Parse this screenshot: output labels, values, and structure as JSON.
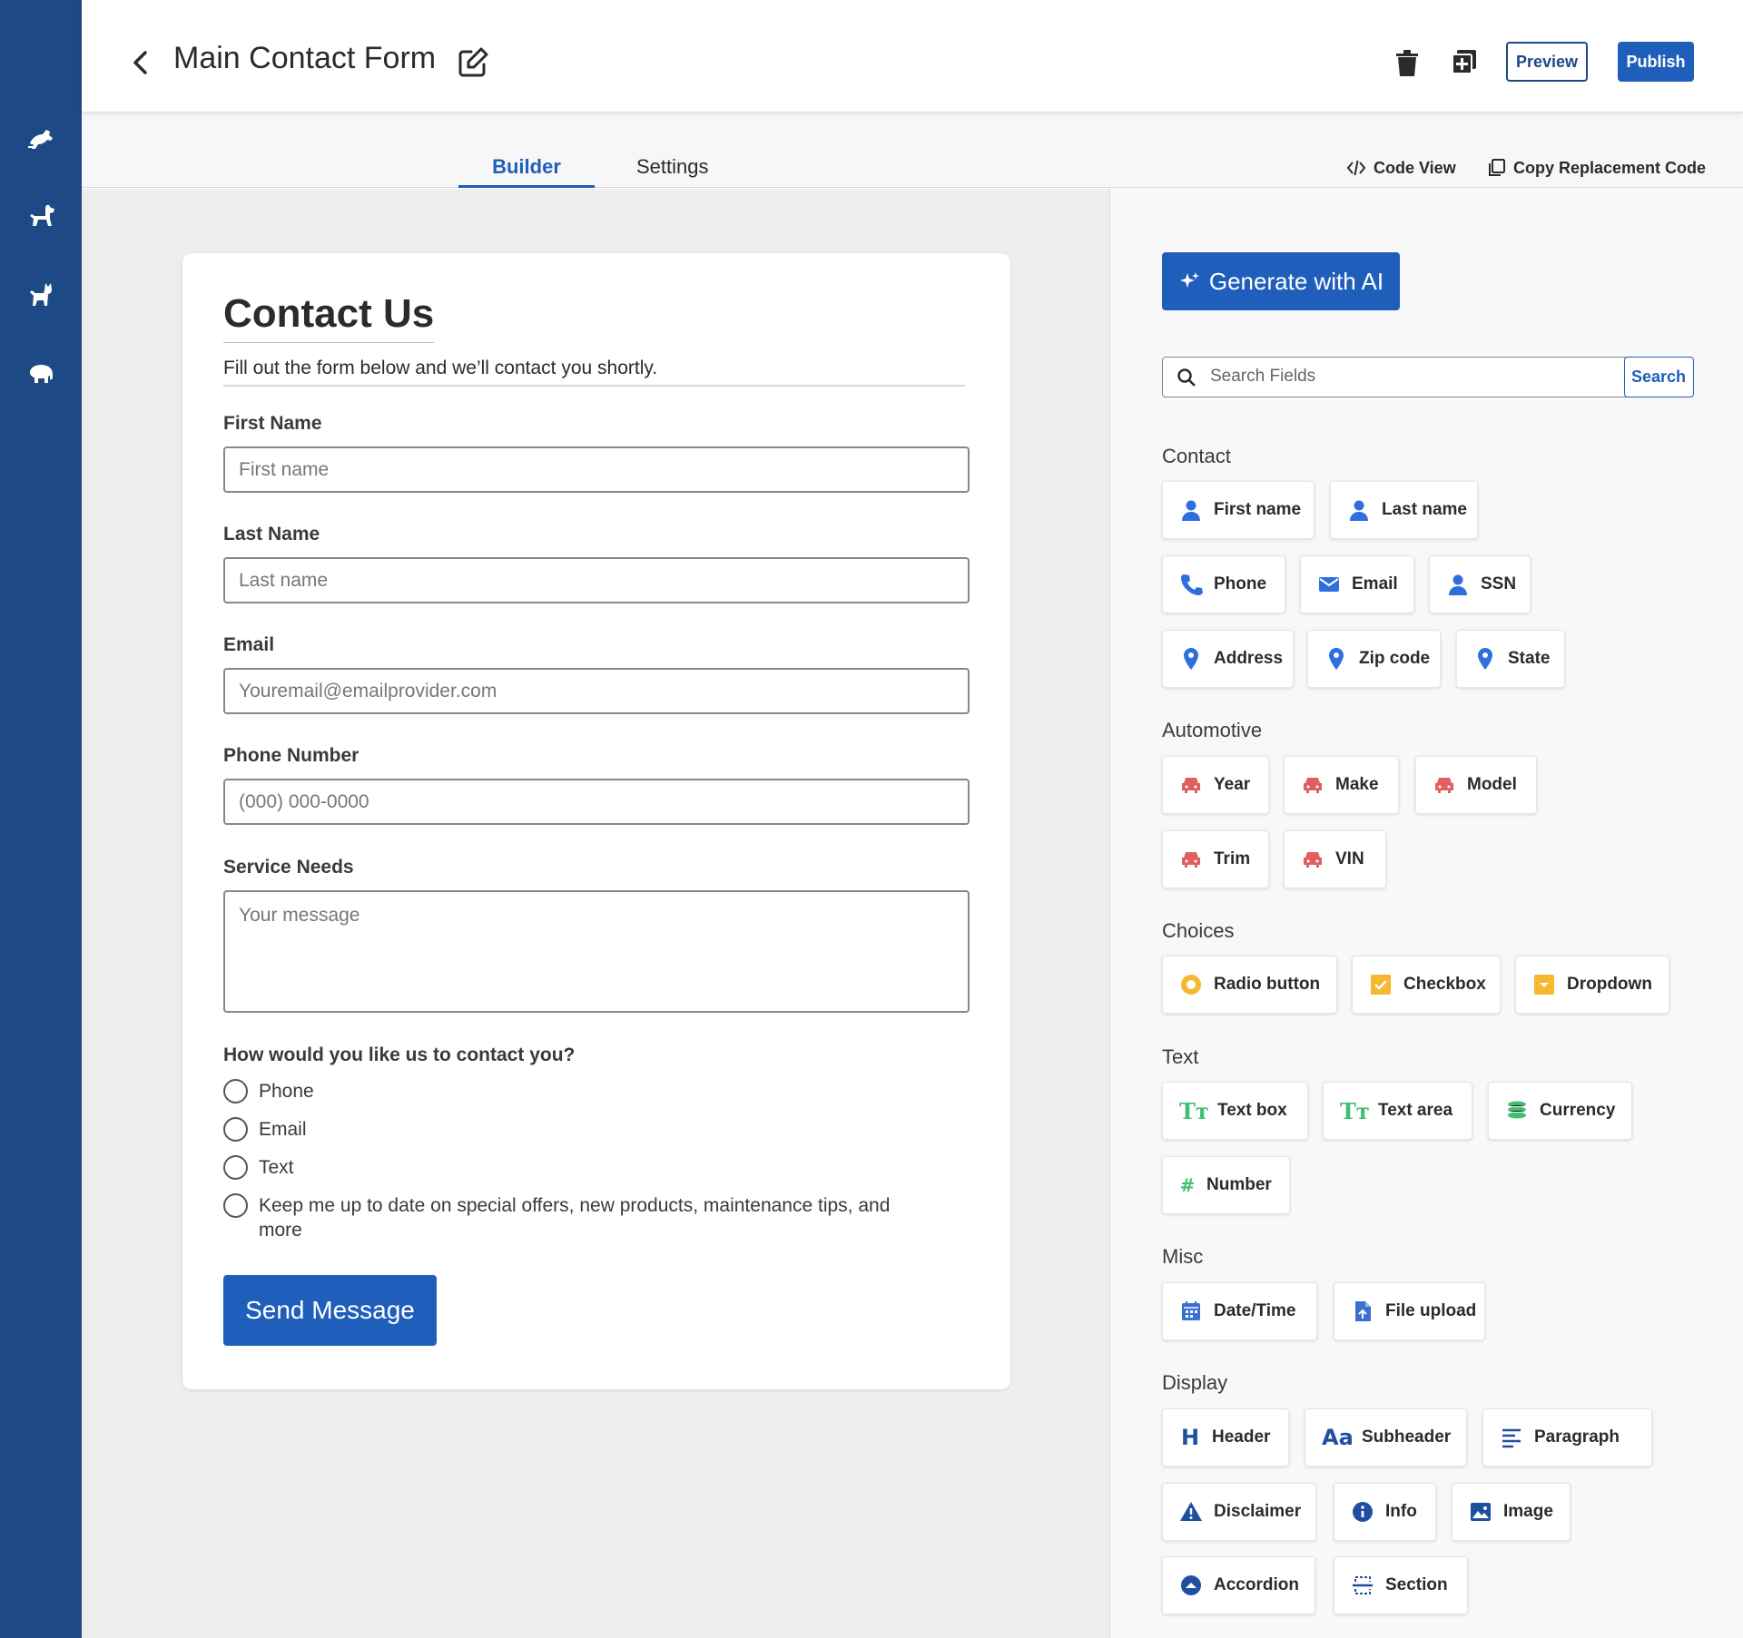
{
  "header": {
    "title": "Main Contact Form",
    "preview_label": "Preview",
    "publish_label": "Publish"
  },
  "tabs": {
    "builder": "Builder",
    "settings": "Settings",
    "code_view": "Code View",
    "copy_code": "Copy Replacement Code"
  },
  "form": {
    "title": "Contact Us",
    "description": "Fill out the form below and we’ll contact you shortly.",
    "first_name": {
      "label": "First Name",
      "placeholder": "First name"
    },
    "last_name": {
      "label": "Last Name",
      "placeholder": "Last name"
    },
    "email": {
      "label": "Email",
      "placeholder": "Youremail@emailprovider.com"
    },
    "phone": {
      "label": "Phone Number",
      "placeholder": "(000) 000-0000"
    },
    "service": {
      "label": "Service Needs",
      "placeholder": "Your message"
    },
    "contact_question": "How would you like us to contact you?",
    "contact_options": [
      "Phone",
      "Email",
      "Text",
      "Keep me up to date on special offers, new products, maintenance tips, and more"
    ],
    "submit_label": "Send Message"
  },
  "panel": {
    "ai_label": "Generate with AI",
    "search_placeholder": "Search Fields",
    "search_button": "Search",
    "categories": {
      "contact": "Contact",
      "automotive": "Automotive",
      "choices": "Choices",
      "text": "Text",
      "misc": "Misc",
      "display": "Display"
    },
    "chips": {
      "first_name": "First name",
      "last_name": "Last name",
      "phone": "Phone",
      "email": "Email",
      "ssn": "SSN",
      "address": "Address",
      "zip": "Zip code",
      "state": "State",
      "year": "Year",
      "make": "Make",
      "model": "Model",
      "trim": "Trim",
      "vin": "VIN",
      "radio": "Radio button",
      "checkbox": "Checkbox",
      "dropdown": "Dropdown",
      "textbox": "Text box",
      "textarea": "Text area",
      "currency": "Currency",
      "number": "Number",
      "datetime": "Date/Time",
      "upload": "File upload",
      "header": "Header",
      "subheader": "Subheader",
      "paragraph": "Paragraph",
      "disclaimer": "Disclaimer",
      "info": "Info",
      "image": "Image",
      "accordion": "Accordion",
      "section": "Section"
    }
  },
  "colors": {
    "rail": "#1d4a84",
    "primary": "#1f5fbb",
    "contact_icon": "#2f6fdd",
    "auto_icon": "#e06060",
    "choice_icon": "#f5b82e",
    "text_icon": "#3fbf6f",
    "misc_icon": "#3b6fd0",
    "display_icon": "#1f4fa0"
  }
}
